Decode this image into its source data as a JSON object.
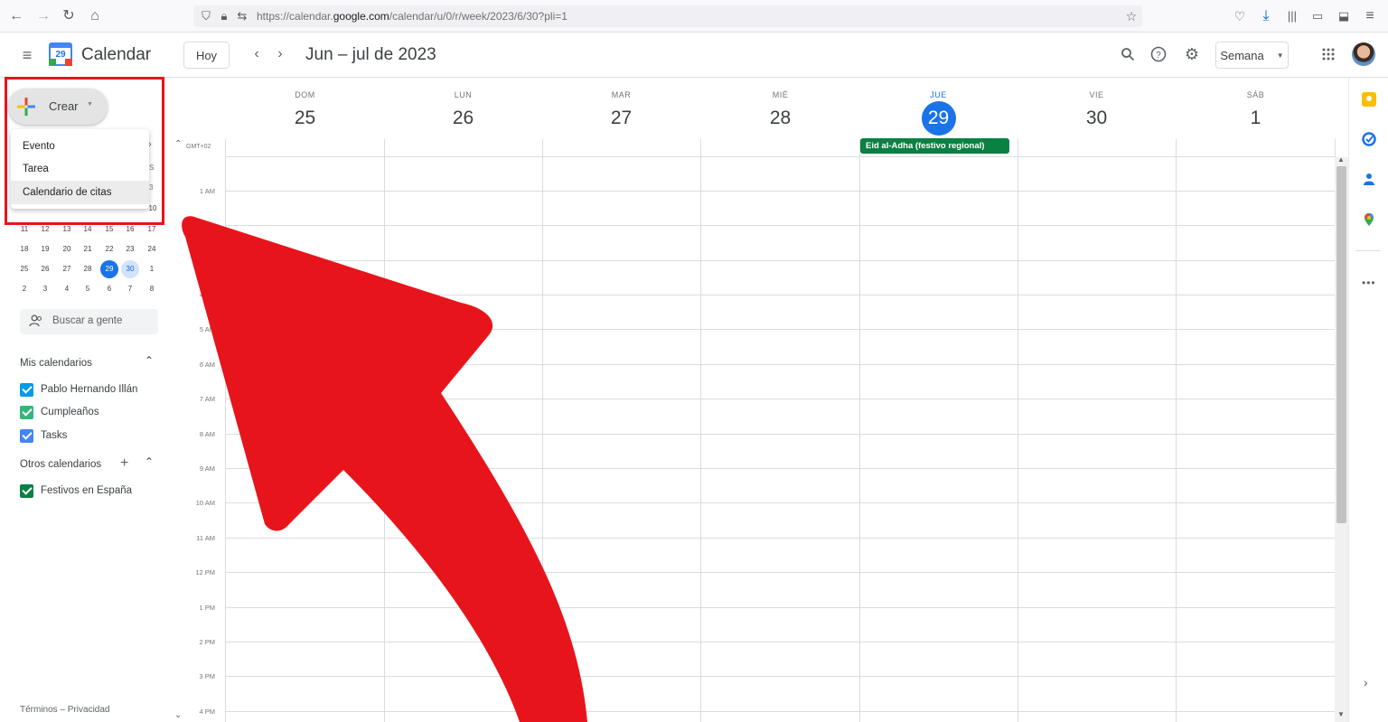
{
  "browser": {
    "url_prefix": "https://calendar.",
    "url_domain": "google.com",
    "url_path": "/calendar/u/0/r/week/2023/6/30?pli=1"
  },
  "header": {
    "app_title": "Calendar",
    "logo_number": "29",
    "today_label": "Hoy",
    "date_range": "Jun – jul de 2023",
    "view_label": "Semana"
  },
  "sidebar": {
    "create_label": "Crear",
    "create_menu": [
      "Evento",
      "Tarea",
      "Calendario de citas"
    ],
    "mini_calendar": {
      "partial_row": [
        "",
        "",
        "",
        "",
        "",
        "",
        "10"
      ],
      "rows": [
        [
          "11",
          "12",
          "13",
          "14",
          "15",
          "16",
          "17"
        ],
        [
          "18",
          "19",
          "20",
          "21",
          "22",
          "23",
          "24"
        ],
        [
          "25",
          "26",
          "27",
          "28",
          "29",
          "30",
          "1"
        ],
        [
          "2",
          "3",
          "4",
          "5",
          "6",
          "7",
          "8"
        ]
      ],
      "today": "29",
      "selected": "30"
    },
    "search_people_placeholder": "Buscar a gente",
    "my_calendars_title": "Mis calendarios",
    "my_calendars": [
      {
        "name": "Pablo Hernando Illán",
        "color": "#039be5"
      },
      {
        "name": "Cumpleaños",
        "color": "#33b679"
      },
      {
        "name": "Tasks",
        "color": "#4285f4"
      }
    ],
    "other_calendars_title": "Otros calendarios",
    "other_calendars": [
      {
        "name": "Festivos en España",
        "color": "#0b8043"
      }
    ],
    "footer": "Términos – Privacidad"
  },
  "week": {
    "timezone": "GMT+02",
    "days": [
      {
        "name": "DOM",
        "num": "25"
      },
      {
        "name": "LUN",
        "num": "26"
      },
      {
        "name": "MAR",
        "num": "27"
      },
      {
        "name": "MIÉ",
        "num": "28"
      },
      {
        "name": "JUE",
        "num": "29",
        "today": true
      },
      {
        "name": "VIE",
        "num": "30"
      },
      {
        "name": "SÁB",
        "num": "1"
      }
    ],
    "hours": [
      "1 AM",
      "2 AM",
      "3 AM",
      "4 AM",
      "5 AM",
      "6 AM",
      "7 AM",
      "8 AM",
      "9 AM",
      "10 AM",
      "11 AM",
      "12 PM",
      "1 PM",
      "2 PM",
      "3 PM",
      "4 PM"
    ],
    "all_day_event": "Eid al-Adha (festivo regional)"
  },
  "colors": {
    "accent": "#1a73e8",
    "highlight_box": "#e8141b",
    "arrow": "#e8141b",
    "event": "#0b8043"
  }
}
